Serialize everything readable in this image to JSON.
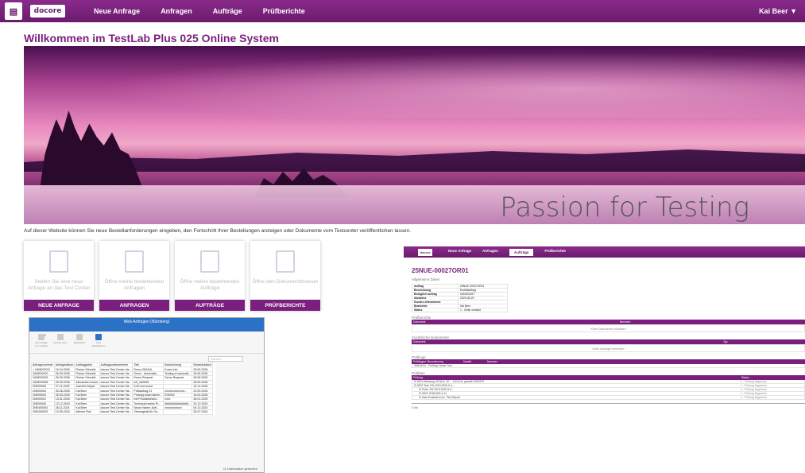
{
  "header": {
    "logo": "docore",
    "nav": [
      "Neue Anfrage",
      "Anfragen",
      "Aufträge",
      "Prüfberichte"
    ],
    "user": "Kai Beer ▼"
  },
  "page_title": "Willkommen im TestLab Plus 025 Online System",
  "hero_slogan": "Passion for Testing",
  "intro_text": "Auf dieser Website können Sie neue Bestellanforderungen eingeben, den Fortschritt Ihrer Bestellungen anzeigen oder Dokumente vom Testcenter veröffentlichen lassen.",
  "tiles": [
    {
      "text": "Stellen Sie eine neue Anfrage an das Test Center",
      "button": "NEUE ANFRAGE",
      "icon": "document-icon"
    },
    {
      "text": "Öffne meine bestehenden Anfragen",
      "button": "ANFRAGEN",
      "icon": "list-check-icon"
    },
    {
      "text": "Öffne meine bestehenden Aufträge",
      "button": "AUFTRÄGE",
      "icon": "list-check-icon"
    },
    {
      "text": "Öffne den Dokumentbrowser",
      "button": "PRÜFBERICHTE",
      "icon": "pdf-icon"
    }
  ],
  "desktop_window": {
    "title": "Web-Anfragen (Nürnberg)",
    "ribbon_tab": "Start",
    "ribbon_buttons": [
      "Als Anfrage zum Auftrag",
      "Auftrag ohne",
      "Bearbeiten",
      "Liste aktualisieren"
    ],
    "search_placeholder": "Suchen",
    "columns": [
      "Anfragenummer",
      "Anfragedatum",
      "Auftraggeber",
      "Auftragsunternehmen",
      "Titel",
      "Bezeichnung",
      "Wunschdatum"
    ],
    "rows": [
      [
        "> 2ANE00011",
        "16.04.2026",
        "Florian Schmidt",
        "docore Test Center Ha...",
        "Demo 200416",
        "Kurze Info",
        "28.05.2026"
      ],
      [
        "2ANE00010",
        "26.05.2026",
        "Florian Schmidt",
        "docore Test Center Ha...",
        "Demo - Automatis...",
        "Testing of automati...",
        "28.06.2026"
      ],
      [
        "2ANE00009",
        "26.05.2026",
        "Florian Schmidt",
        "docore Test Center Ha...",
        "Demo Request",
        "Demo Request",
        "28.06.2026"
      ],
      [
        "2ANE00008",
        "09.05.2026",
        "Alexandra Kolova",
        "docore Test Center Ha...",
        "AS_260505",
        "",
        "28.05.2026"
      ],
      [
        "2NE00006",
        "27.11.2025",
        "Joachim Meyer",
        "docore Test Center Ha...",
        "0,00 und sonst",
        "",
        "15.12.2026"
      ],
      [
        "2NE00004",
        "30.06.2025",
        "Kai Beer",
        "docore Test Center Ha...",
        "Prüfauftrag 01",
        "xxxxxxxxxxxxxx...",
        "23.09.2025"
      ],
      [
        "2NE00003",
        "26.03.2025",
        "Kai Beer",
        "docore Test Center Ha...",
        "Prototyp kann stimm...",
        "E00000",
        "16.04.2025"
      ],
      [
        "2NE00001",
        "13.01.2025",
        "Kai Beer",
        "docore Test Center Ha...",
        "mit Produktbeschr...",
        "xxxx",
        "28.01.2025"
      ],
      [
        "2NE00000",
        "12.12.2024",
        "Kai Beer",
        "docore Test Center Ha...",
        "Technical review Pr...",
        "###############...",
        "20.12.2024"
      ],
      [
        "2NE400004",
        "28.11.2024",
        "Kai Beer",
        "docore Test Center Ha...",
        "Neuer Name: Auft...",
        "xxxxxxxxxxxx",
        "04.12.2024"
      ],
      [
        "2NE400003",
        "13.05.2024",
        "Werner Fink",
        "docore Test Center Ha...",
        "Steuergerät für Gu...",
        "",
        "25.07.2024"
      ]
    ],
    "footer": "11 Datensätze gefunden"
  },
  "order_screen": {
    "logo": "docore",
    "nav": [
      "Neue Anfrage",
      "Anfragen",
      "Aufträge",
      "Prüfberichte"
    ],
    "active_tab": "Aufträge",
    "order_id": "25NUE-00027OR01",
    "general_title": "Allgemeine Daten",
    "general": [
      [
        "Auftrag",
        "25NUE-00027OR01"
      ],
      [
        "Bezeichnung",
        "Erstellauftrag"
      ],
      [
        "Bezüglich Auftrag",
        "2ANE00027"
      ],
      [
        "Abnahme",
        "2025-08-29"
      ],
      [
        "Kunde-Lieferantennr.",
        ""
      ],
      [
        "Bearbeiter",
        "Kai Beer"
      ],
      [
        "Status",
        "1 - Order created"
      ]
    ],
    "reports_title": "Prüfberichte",
    "reports_cols": [
      "Dokument",
      "Benutzer"
    ],
    "reports_empty": "Keine Dokumente vorhanden",
    "docs_title": "Zusätzliche Dokumente",
    "docs_cols": [
      "Dokument",
      "Typ"
    ],
    "docs_empty": "Keine Anhänge vorhanden",
    "items_title": "Prüflinge",
    "items_cols": [
      "Prüflingsnr.",
      "Bezeichnung",
      "Modell",
      "Nummer"
    ],
    "items_rows": [
      [
        "25NUE00...",
        "Prüfling: Neuer Test"
      ]
    ],
    "tests_title": "Prüfplan",
    "tests_cols": [
      "Prüfung",
      "Status"
    ],
    "tests_rows": [
      [
        "⊟ 0001 Messung: 50 kHz, 20 ... 100 kHz, gemäß ISO3370",
        "1 - Prüfung begonnen"
      ],
      [
        "⊟ 0002 Test: EN 2013:2020-9-4...",
        "1 - Prüfung begonnen"
      ],
      [
        "⊟ Prüfz: EN 2013:2020-9-4...",
        "1 - Prüfung begonnen"
      ],
      [
        "⊟ 0003: EN61000-4-11",
        "1 - Prüfung begonnen"
      ],
      [
        "⊟ Data Evaluation inc. Test Report",
        "1 - Prüfung begonnen"
      ]
    ],
    "footer": "© list"
  },
  "colors": {
    "brand": "#7a1f7d",
    "window_blue": "#2b72c6"
  }
}
